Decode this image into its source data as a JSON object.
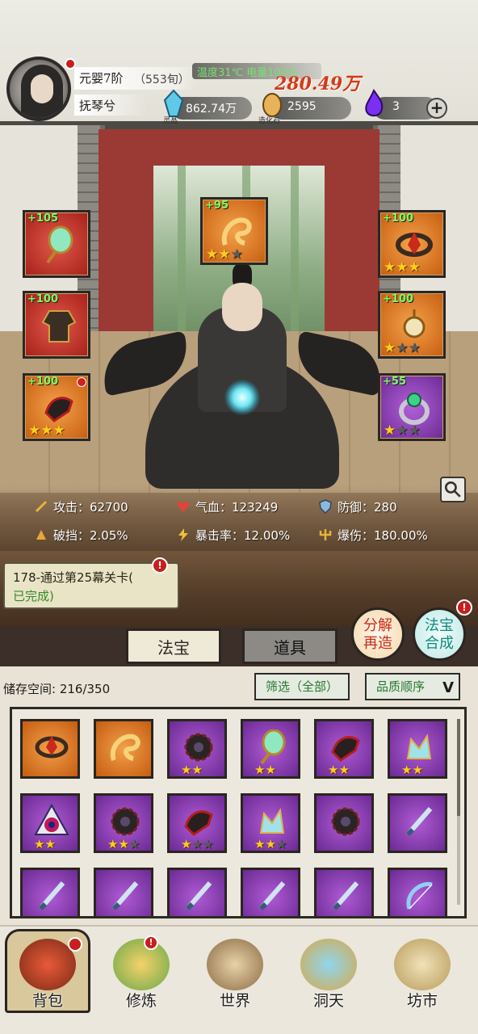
{
  "header": {
    "realm": "元婴7阶",
    "realm_days": "（553旬）",
    "progress_tag": "温度31℃ 电量100%",
    "combat_power": "280.49万",
    "player_name": "抚琴兮"
  },
  "resources": [
    {
      "name": "灵晶",
      "value": "862.74万",
      "icon": "crystal-icon"
    },
    {
      "name": "造化石",
      "value": "2595",
      "icon": "stone-icon"
    },
    {
      "name": "",
      "value": "3",
      "icon": "purple-flame-icon"
    }
  ],
  "equipment": {
    "left": [
      {
        "plus": "+105",
        "rarity": "red",
        "icon": "fan-icon",
        "stars": 0,
        "dot": false
      },
      {
        "plus": "+100",
        "rarity": "red",
        "icon": "robe-icon",
        "stars": 0,
        "dot": false
      },
      {
        "plus": "+100",
        "rarity": "orange",
        "icon": "boots-icon",
        "stars": 3,
        "dot": true
      }
    ],
    "center": {
      "plus": "+95",
      "rarity": "orange",
      "icon": "dragon-icon",
      "stars": 2,
      "max_stars": 3
    },
    "right": [
      {
        "plus": "+100",
        "rarity": "orange",
        "icon": "bracer-icon",
        "stars": 3,
        "max_stars": 3
      },
      {
        "plus": "+100",
        "rarity": "orange",
        "icon": "pendant-icon",
        "stars": 1,
        "max_stars": 3
      },
      {
        "plus": "+55",
        "rarity": "purple",
        "icon": "ring-icon",
        "stars": 1,
        "max_stars": 3
      }
    ]
  },
  "stats": {
    "attack": "攻击：62700",
    "hp": "气血：123249",
    "defense": "防御：280",
    "block_break": "破挡：2.05%",
    "crit_rate": "暴击率：12.00%",
    "crit_damage": "爆伤：180.00%"
  },
  "quest": {
    "line1": "178-通过第25幕关卡(",
    "line2": "已完成)",
    "badge": "!"
  },
  "tabs": [
    "法宝",
    "道具"
  ],
  "actions": {
    "decompose": [
      "分解",
      "再造"
    ],
    "synthesize": [
      "法宝",
      "合成"
    ],
    "badge": "!"
  },
  "inventory": {
    "storage": "储存空间:  216/350",
    "filter": "筛选（全部）",
    "sort": "品质顺序",
    "items": [
      {
        "rarity": "orange",
        "icon": "bracer-icon",
        "stars": 0
      },
      {
        "rarity": "orange",
        "icon": "dragon-icon",
        "stars": 0
      },
      {
        "rarity": "purple",
        "icon": "saw-blade-icon",
        "stars": 2
      },
      {
        "rarity": "purple",
        "icon": "fan-icon",
        "stars": 2
      },
      {
        "rarity": "purple",
        "icon": "boots-icon",
        "stars": 2
      },
      {
        "rarity": "purple",
        "icon": "crown-icon",
        "stars": 2
      },
      {
        "rarity": "purple",
        "icon": "yinyang-icon",
        "stars": 2
      },
      {
        "rarity": "purple",
        "icon": "saw-blade-icon",
        "stars": 2,
        "max": 3
      },
      {
        "rarity": "purple",
        "icon": "boots-icon",
        "stars": 1,
        "max": 3
      },
      {
        "rarity": "purple",
        "icon": "crown-icon",
        "stars": 2,
        "max": 3
      },
      {
        "rarity": "purple",
        "icon": "saw-blade-icon",
        "stars": 0
      },
      {
        "rarity": "purple",
        "icon": "sword-icon",
        "stars": 0
      },
      {
        "rarity": "purple",
        "icon": "sword-icon",
        "stars": 0
      },
      {
        "rarity": "purple",
        "icon": "sword-icon",
        "stars": 0
      },
      {
        "rarity": "purple",
        "icon": "sword-icon",
        "stars": 0
      },
      {
        "rarity": "purple",
        "icon": "sword-icon",
        "stars": 0
      },
      {
        "rarity": "purple",
        "icon": "sword-icon",
        "stars": 0
      },
      {
        "rarity": "purple",
        "icon": "bow-icon",
        "stars": 0
      }
    ]
  },
  "nav": [
    {
      "label": "背包",
      "icon": "bag-icon",
      "active": true,
      "badge": false
    },
    {
      "label": "修炼",
      "icon": "lotus-icon",
      "active": false,
      "badge": true
    },
    {
      "label": "世界",
      "icon": "scroll-map-icon",
      "active": false,
      "badge": false
    },
    {
      "label": "洞天",
      "icon": "portal-icon",
      "active": false,
      "badge": false
    },
    {
      "label": "坊市",
      "icon": "market-icon",
      "active": false,
      "badge": false
    }
  ],
  "colors": {
    "red_rarity": "#a71f1a",
    "orange_rarity": "#c75d11",
    "purple_rarity": "#6b2a93",
    "star": "#ffcc1f",
    "power": "#d33a17",
    "done": "#2f8d2a"
  }
}
